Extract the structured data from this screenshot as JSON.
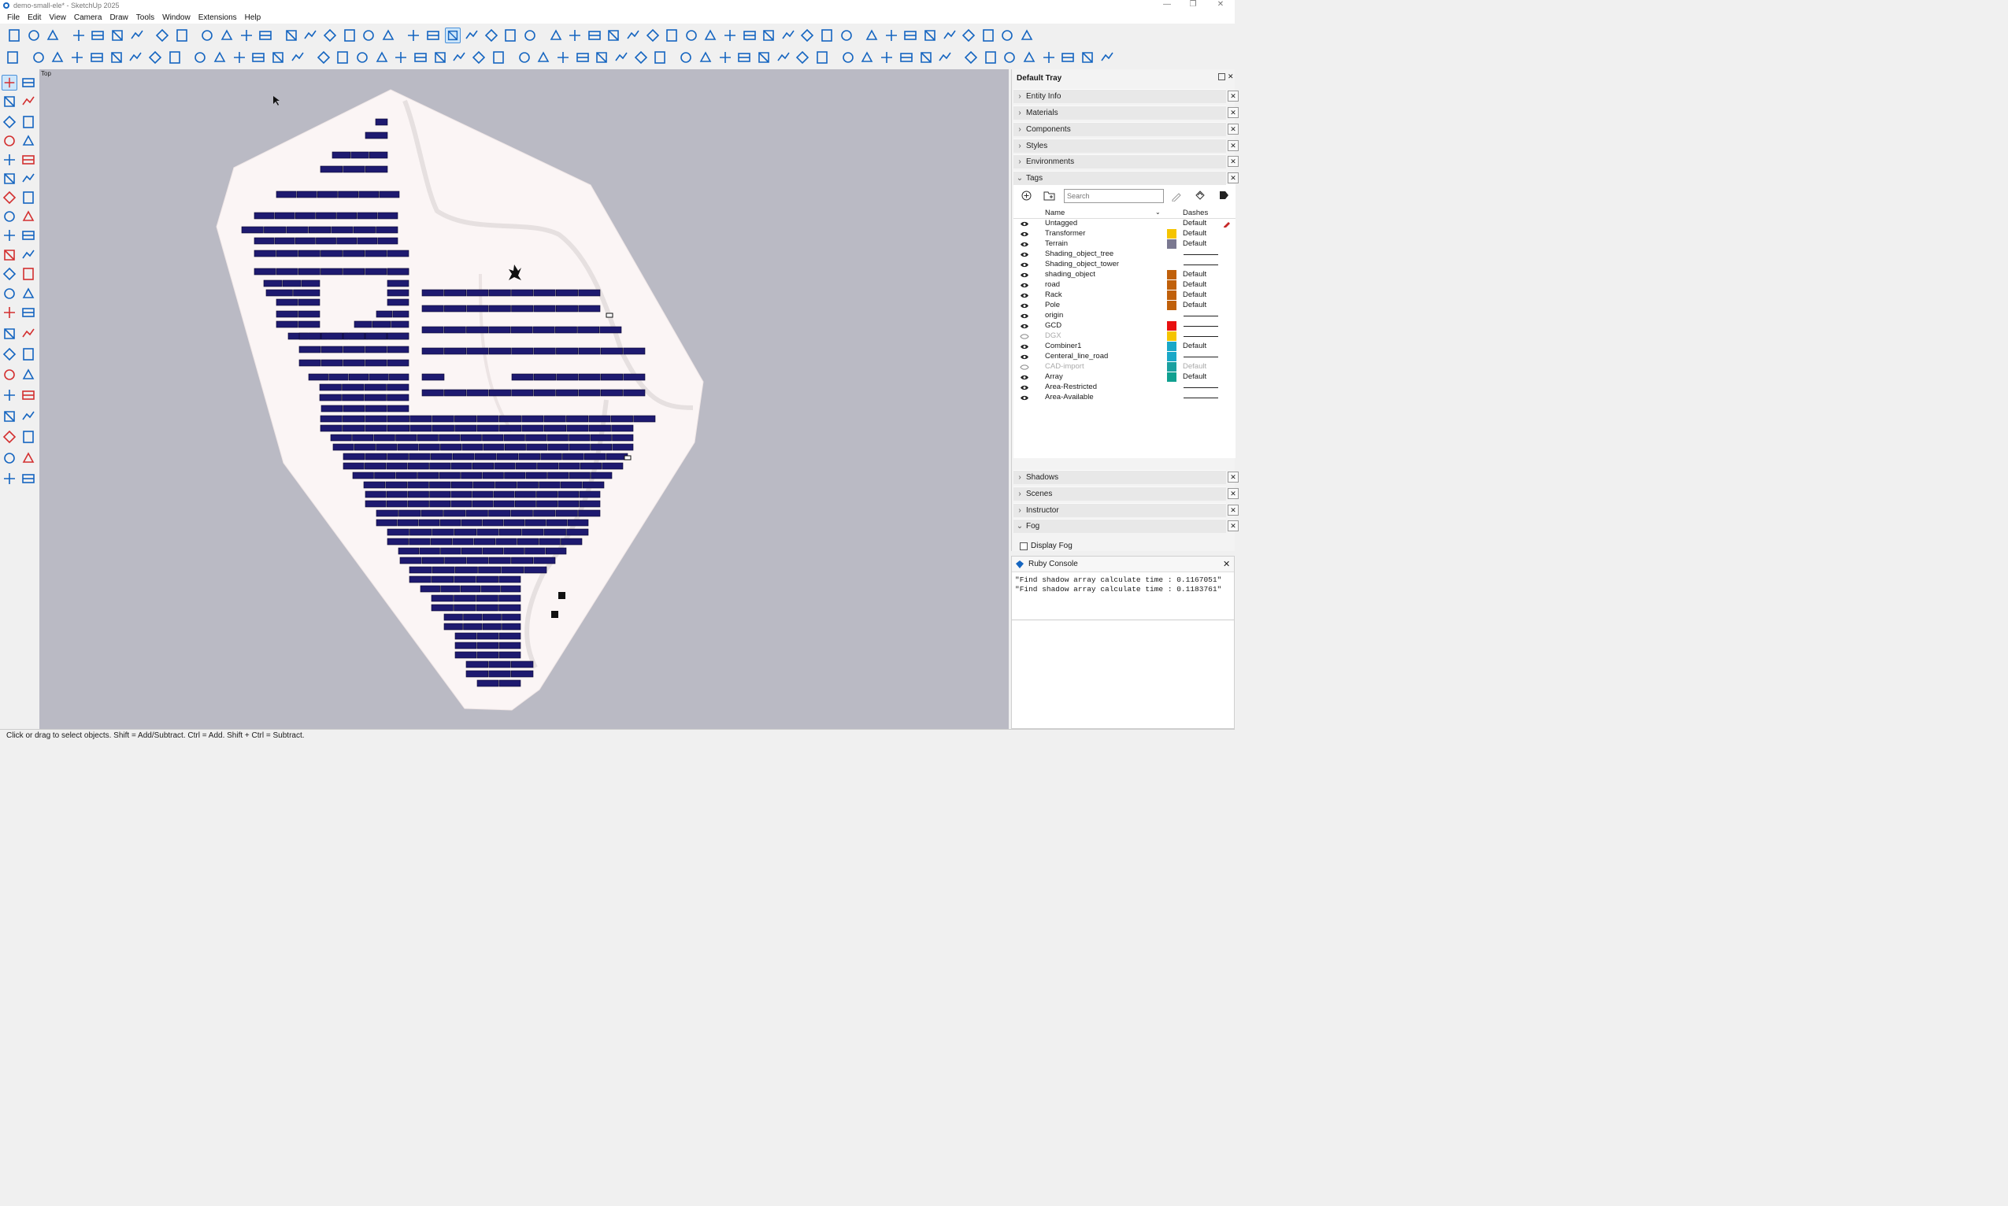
{
  "window": {
    "title": "demo-small-ele* - SketchUp 2025",
    "controls": [
      "—",
      "❐",
      "✕"
    ]
  },
  "menu": [
    "File",
    "Edit",
    "View",
    "Camera",
    "Draw",
    "Tools",
    "Window",
    "Extensions",
    "Help"
  ],
  "toolbar_icons_row1": [
    "new-file",
    "open-folder",
    "save",
    "cut",
    "copy",
    "paste",
    "erase",
    "undo",
    "redo",
    "print",
    "model-info",
    "iso-view",
    "top-view",
    "front-view",
    "right-view",
    "back-view",
    "left-view",
    "xray",
    "wireframe",
    "hidden-line",
    "shaded",
    "shaded-textures",
    "monochrome",
    "ambient",
    "search",
    "tape-measure",
    "dimension",
    "protractor",
    "text",
    "axes",
    "lock",
    "terrain",
    "transformer",
    "layout",
    "grid",
    "road",
    "cad",
    "measure",
    "auto",
    "pile",
    "array",
    "house",
    "label",
    "tower",
    "tree",
    "pole",
    "rack",
    "cube",
    "fence",
    "export",
    "hide"
  ],
  "toolbar_icons_row2": [
    "list",
    "sun",
    "globe",
    "frame",
    "mountain",
    "mountain2",
    "bars",
    "flat-panel",
    "tilt-panel",
    "grid-panel",
    "delete",
    "percent",
    "scatter",
    "sparkle",
    "cable",
    "layout2",
    "bus",
    "switch",
    "zoom-eye",
    "dollar",
    "fork",
    "earth",
    "link",
    "bar-grid",
    "net",
    "clone",
    "add",
    "upload",
    "ruler",
    "tree-nav",
    "chart",
    "flag",
    "cross",
    "table",
    "sliders",
    "boxes",
    "coins",
    "money",
    "kwh",
    "irr",
    "clipboard",
    "settings",
    "energy",
    "en",
    "help",
    "cloud",
    "refresh",
    "stack",
    "loss",
    "bi",
    "play",
    "node",
    "node2",
    "node3",
    "gbl"
  ],
  "viewport": {
    "view_label": "Top",
    "site_color": "#fbf5f5",
    "background_color": "#babac4",
    "panel_color": "#1e1a70"
  },
  "tray": {
    "title": "Default Tray",
    "panels_top": [
      "Entity Info",
      "Materials",
      "Components",
      "Styles",
      "Environments",
      "Tags"
    ],
    "panels_bottom": [
      "Shadows",
      "Scenes",
      "Instructor",
      "Fog"
    ],
    "fog_checkbox": "Display Fog",
    "tags_search_placeholder": "Search",
    "tags_headers": {
      "name": "Name",
      "dashes": "Dashes"
    },
    "tags": [
      {
        "name": "Untagged",
        "color": "",
        "dashes": "Default",
        "visible": true
      },
      {
        "name": "Transformer",
        "color": "#f5c400",
        "dashes": "Default",
        "visible": true
      },
      {
        "name": "Terrain",
        "color": "#7a7890",
        "dashes": "Default",
        "visible": true
      },
      {
        "name": "Shading_object_tree",
        "color": "",
        "dashes": "",
        "visible": true
      },
      {
        "name": "Shading_object_tower",
        "color": "",
        "dashes": "",
        "visible": true
      },
      {
        "name": "shading_object",
        "color": "#c0600a",
        "dashes": "Default",
        "visible": true
      },
      {
        "name": "road",
        "color": "#c0600a",
        "dashes": "Default",
        "visible": true
      },
      {
        "name": "Rack",
        "color": "#c0600a",
        "dashes": "Default",
        "visible": true
      },
      {
        "name": "Pole",
        "color": "#c0600a",
        "dashes": "Default",
        "visible": true
      },
      {
        "name": "origin",
        "color": "",
        "dashes": "",
        "visible": true
      },
      {
        "name": "GCD",
        "color": "#e81010",
        "dashes": "",
        "visible": true
      },
      {
        "name": "DGX",
        "color": "#f5c400",
        "dashes": "",
        "visible": false
      },
      {
        "name": "Combiner1",
        "color": "#1aa8c8",
        "dashes": "Default",
        "visible": true
      },
      {
        "name": "Centeral_line_road",
        "color": "#1aa8c8",
        "dashes": "",
        "visible": true
      },
      {
        "name": "CAD-import",
        "color": "#1aa0a0",
        "dashes": "Default",
        "visible": false
      },
      {
        "name": "Array",
        "color": "#10a090",
        "dashes": "Default",
        "visible": true
      },
      {
        "name": "Area-Restricted",
        "color": "",
        "dashes": "",
        "visible": true
      },
      {
        "name": "Area-Available",
        "color": "",
        "dashes": "",
        "visible": true
      }
    ]
  },
  "ruby_console": {
    "title": "Ruby Console",
    "output": "\"Find shadow array calculate time : 0.1167051\"\n\"Find shadow array calculate time : 0.1183761\""
  },
  "status": "Click or drag to select objects. Shift = Add/Subtract. Ctrl = Add. Shift + Ctrl = Subtract."
}
